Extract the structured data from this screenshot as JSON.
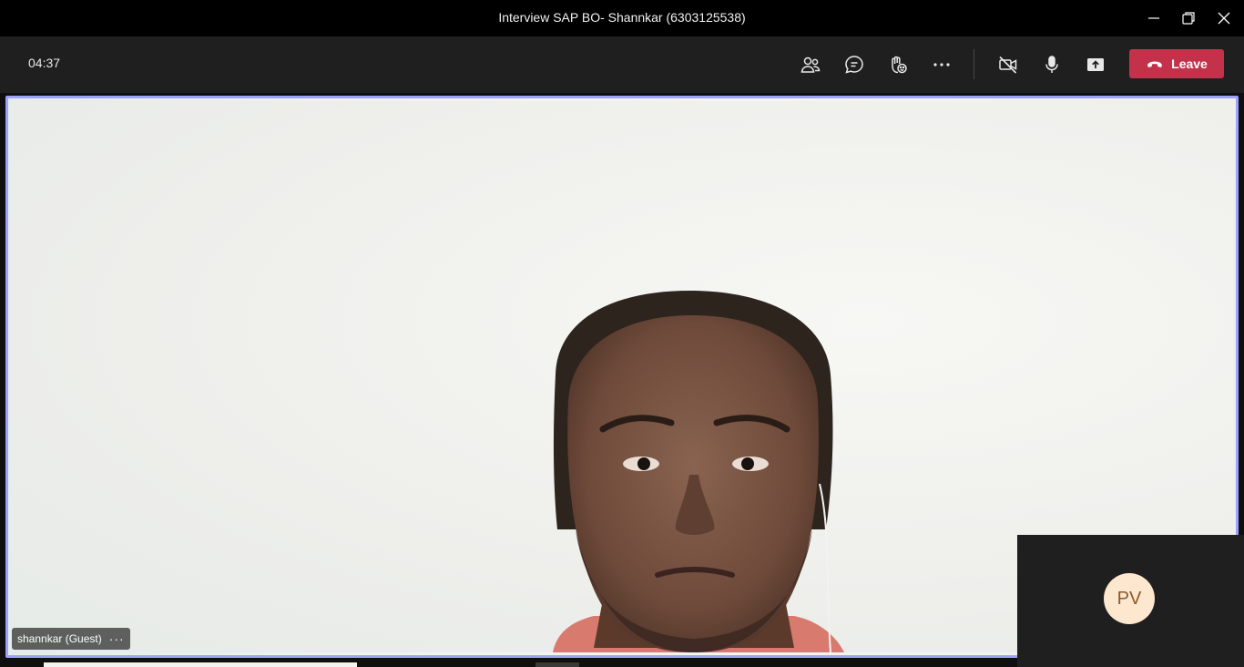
{
  "window": {
    "title": "Interview SAP BO- Shannkar (6303125538)"
  },
  "toolbar": {
    "timer": "04:37",
    "buttons": [
      {
        "name": "participants",
        "icon": "participants-icon"
      },
      {
        "name": "chat",
        "icon": "chat-icon"
      },
      {
        "name": "raise-hand",
        "icon": "raise-hand-icon"
      },
      {
        "name": "more-actions",
        "icon": "more-icon"
      },
      {
        "name": "camera",
        "icon": "camera-off-icon"
      },
      {
        "name": "mic",
        "icon": "mic-icon"
      },
      {
        "name": "share",
        "icon": "share-icon"
      }
    ],
    "leave_label": "Leave"
  },
  "stage": {
    "participant_name": "shannkar (Guest)",
    "participant_more": "···",
    "self_initials": "PV"
  },
  "colors": {
    "accent_border": "#9ea2ff",
    "leave_red": "#c4314b",
    "avatar_bg": "#fde7cf",
    "avatar_text": "#8a5a2b"
  }
}
